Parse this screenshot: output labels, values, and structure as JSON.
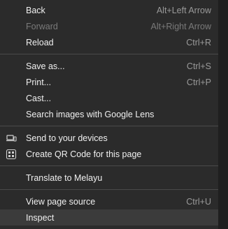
{
  "menu": {
    "items": [
      {
        "label": "Back",
        "shortcut": "Alt+Left Arrow"
      },
      {
        "label": "Forward",
        "shortcut": "Alt+Right Arrow",
        "disabled": true
      },
      {
        "label": "Reload",
        "shortcut": "Ctrl+R"
      },
      {
        "label": "Save as...",
        "shortcut": "Ctrl+S"
      },
      {
        "label": "Print...",
        "shortcut": "Ctrl+P"
      },
      {
        "label": "Cast...",
        "shortcut": ""
      },
      {
        "label": "Search images with Google Lens",
        "shortcut": ""
      },
      {
        "label": "Send to your devices",
        "shortcut": "",
        "icon": "devices-icon"
      },
      {
        "label": "Create QR Code for this page",
        "shortcut": "",
        "icon": "qr-code-icon"
      },
      {
        "label": "Translate to Melayu",
        "shortcut": ""
      },
      {
        "label": "View page source",
        "shortcut": "Ctrl+U"
      },
      {
        "label": "Inspect",
        "shortcut": "",
        "highlighted": true
      }
    ]
  }
}
